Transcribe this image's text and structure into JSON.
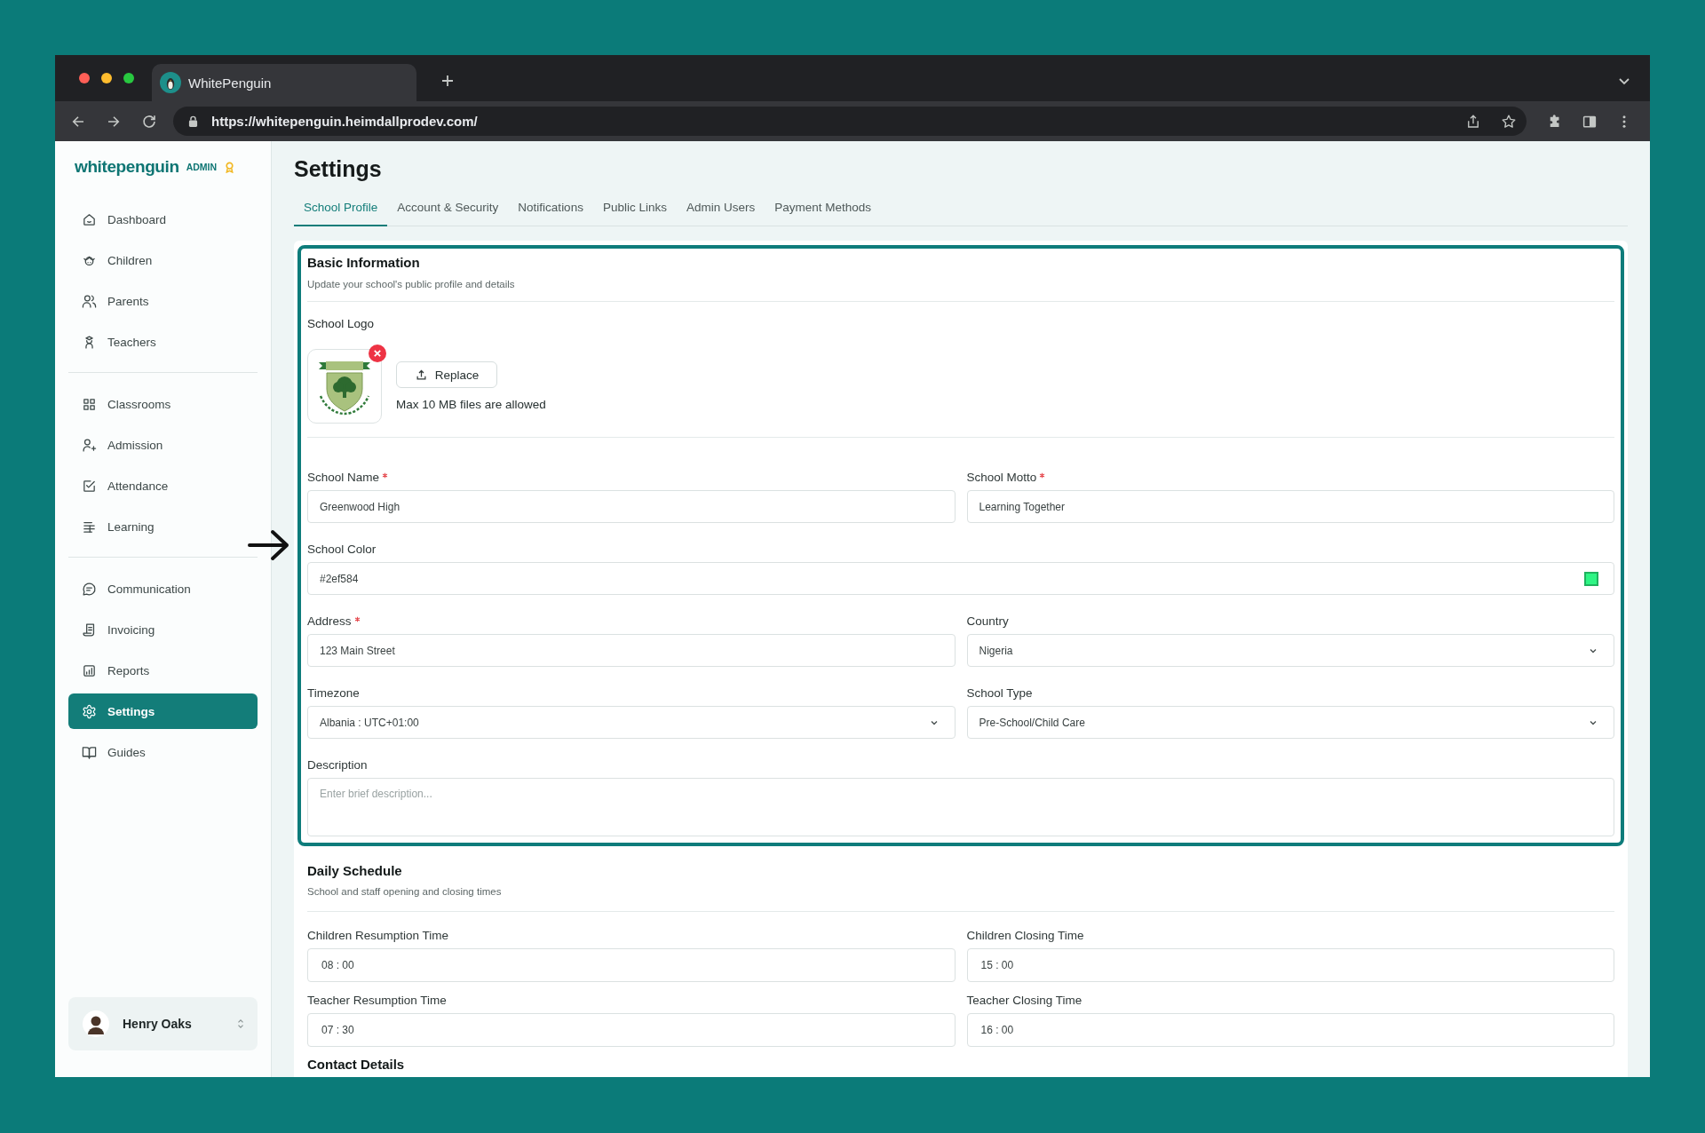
{
  "browser": {
    "tab_title": "WhitePenguin",
    "url": "https://whitepenguin.heimdallprodev.com/"
  },
  "sidebar": {
    "brand": "whitepenguin",
    "badge": "ADMIN",
    "groups": [
      {
        "items": [
          {
            "label": "Dashboard",
            "selected": false
          },
          {
            "label": "Children",
            "selected": false
          },
          {
            "label": "Parents",
            "selected": false
          },
          {
            "label": "Teachers",
            "selected": false
          }
        ]
      },
      {
        "items": [
          {
            "label": "Classrooms",
            "selected": false
          },
          {
            "label": "Admission",
            "selected": false
          },
          {
            "label": "Attendance",
            "selected": false
          },
          {
            "label": "Learning",
            "selected": false
          }
        ]
      },
      {
        "items": [
          {
            "label": "Communication",
            "selected": false
          },
          {
            "label": "Invoicing",
            "selected": false
          },
          {
            "label": "Reports",
            "selected": false
          },
          {
            "label": "Settings",
            "selected": true
          },
          {
            "label": "Guides",
            "selected": false
          }
        ]
      }
    ],
    "user": {
      "name": "Henry Oaks"
    }
  },
  "header": {
    "title": "Settings",
    "tabs": [
      {
        "label": "School Profile",
        "selected": true
      },
      {
        "label": "Account & Security",
        "selected": false
      },
      {
        "label": "Notifications",
        "selected": false
      },
      {
        "label": "Public Links",
        "selected": false
      },
      {
        "label": "Admin Users",
        "selected": false
      },
      {
        "label": "Payment Methods",
        "selected": false
      }
    ]
  },
  "basic_info": {
    "title": "Basic Information",
    "subtitle": "Update your school's public profile and details",
    "highlighted": true,
    "logo": {
      "label": "School Logo",
      "button": "Replace",
      "hint": "Max 10 MB files are allowed"
    },
    "fields": [
      {
        "kind": "text",
        "label": "School Name",
        "required": true,
        "pointed": false,
        "value": "Greenwood High"
      },
      {
        "kind": "text",
        "label": "School Motto",
        "required": true,
        "pointed": false,
        "value": "Learning Together"
      },
      {
        "kind": "color",
        "label": "School Color",
        "required": false,
        "pointed": true,
        "value": "#2ef584",
        "color": "#2ef584"
      },
      {
        "kind": "text",
        "label": "Address",
        "required": true,
        "pointed": false,
        "value": "123 Main Street"
      },
      {
        "kind": "select",
        "label": "Country",
        "required": false,
        "pointed": false,
        "value": "Nigeria"
      },
      {
        "kind": "select",
        "label": "Timezone",
        "required": false,
        "pointed": false,
        "value": "Albania : UTC+01:00"
      },
      {
        "kind": "select",
        "label": "School Type",
        "required": false,
        "pointed": false,
        "value": "Pre-School/Child Care"
      },
      {
        "kind": "textarea",
        "label": "Description",
        "required": false,
        "pointed": false,
        "placeholder": "Enter brief description..."
      }
    ]
  },
  "daily_schedule": {
    "title": "Daily Schedule",
    "subtitle": "School and staff opening and closing times",
    "fields": [
      {
        "label": "Children Resumption Time",
        "value": "08 : 00"
      },
      {
        "label": "Children Closing Time",
        "value": "15 : 00"
      },
      {
        "label": "Teacher Resumption Time",
        "value": "07 : 30"
      },
      {
        "label": "Teacher Closing Time",
        "value": "16 : 00"
      }
    ]
  },
  "contact_details": {
    "title": "Contact Details"
  }
}
